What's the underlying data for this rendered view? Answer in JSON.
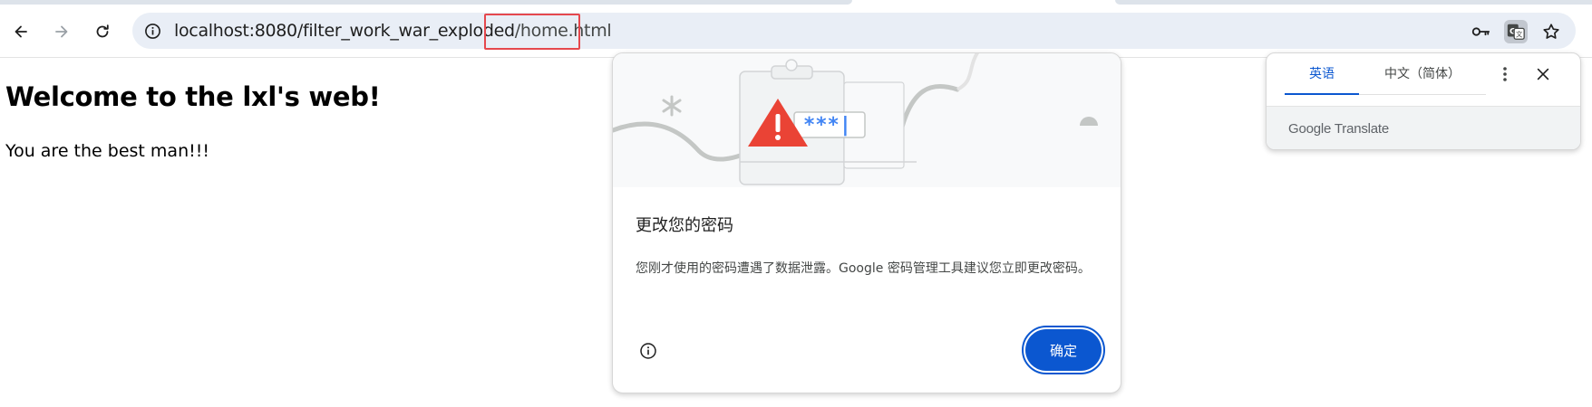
{
  "browser": {
    "address_bar": {
      "url_host": "localhost:8080/filter_work_war_exploded",
      "url_path": "/home.html"
    },
    "icons": {
      "back": "arrow-left-icon",
      "forward": "arrow-right-icon",
      "reload": "reload-icon",
      "site_info": "info-icon",
      "password": "key-icon",
      "translate": "translate-icon",
      "bookmark": "star-icon"
    },
    "colors": {
      "omnibox_bg": "#e9eef6",
      "highlight": "#e5484d",
      "accent": "#0b57d0"
    }
  },
  "page": {
    "heading": "Welcome to the lxl's web!",
    "text": "You are the best man!!!"
  },
  "password_dialog": {
    "illustration_text": "***|",
    "title": "更改您的密码",
    "body": "您刚才使用的密码遭遇了数据泄露。Google 密码管理工具建议您立即更改密码。",
    "ok_label": "确定",
    "info_icon": "info-icon"
  },
  "translate_bubble": {
    "tabs": [
      "英语",
      "中文（简体）"
    ],
    "active_tab": "英语",
    "more_icon": "more-vert-icon",
    "close_icon": "close-icon",
    "footer": "Google Translate"
  }
}
